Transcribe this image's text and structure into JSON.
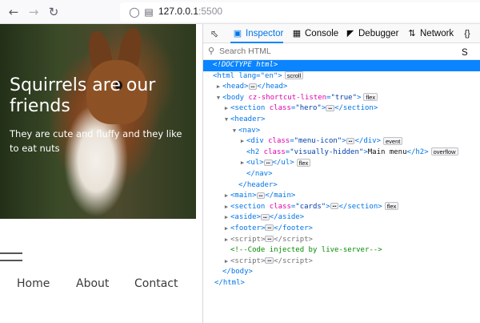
{
  "browser": {
    "url_host": "127.0.0.1",
    "url_port": ":5500",
    "back_icon": "arrow-left-icon",
    "forward_icon": "arrow-right-icon",
    "reload_icon": "reload-icon"
  },
  "page": {
    "hero_title": "Squirrels are our friends",
    "hero_subtitle": "They are cute and fluffy and they like to eat nuts",
    "nav": [
      "Home",
      "About",
      "Contact"
    ]
  },
  "devtools": {
    "tabs": [
      {
        "label": "Inspector",
        "icon": "inspector-icon"
      },
      {
        "label": "Console",
        "icon": "console-icon"
      },
      {
        "label": "Debugger",
        "icon": "debugger-icon"
      },
      {
        "label": "Network",
        "icon": "network-icon"
      },
      {
        "label": "S",
        "icon": "style-editor-icon"
      }
    ],
    "search_placeholder": "Search HTML",
    "tree": {
      "doctype": "<!DOCTYPE html>",
      "html_open": "<html lang=\"en\">",
      "scroll_badge": "scroll",
      "head": "head",
      "body_attr": "cz-shortcut-listen",
      "body_val": "\"true\"",
      "flex_badge": "flex",
      "section": "section",
      "hero_class": "\"hero\"",
      "header": "header",
      "nav": "nav",
      "div": "div",
      "menu_icon_class": "\"menu-icon\"",
      "event_badge": "event",
      "h2": "h2",
      "visually_hidden_class": "\"visually-hidden\"",
      "main_menu_text": "Main menu",
      "overflow_badge": "overflow",
      "ul": "ul",
      "main": "main",
      "cards_class": "\"cards\"",
      "aside": "aside",
      "footer": "footer",
      "script": "script",
      "comment": "<!--Code injected by live-server-->",
      "body": "body",
      "html": "html"
    }
  }
}
